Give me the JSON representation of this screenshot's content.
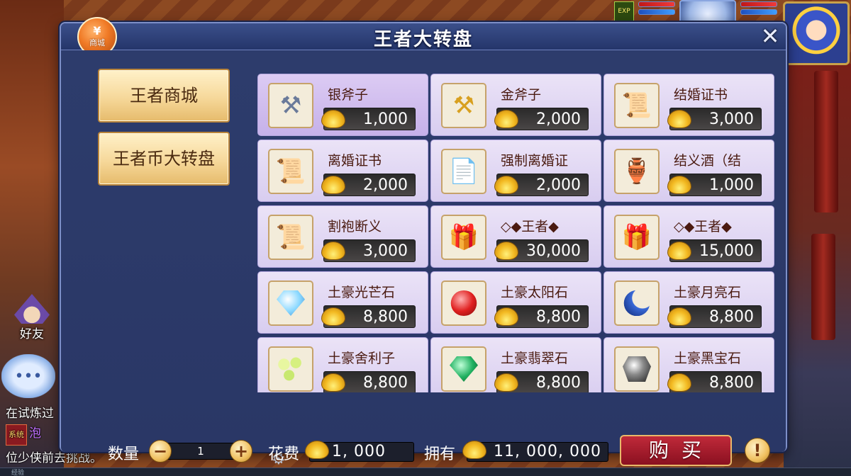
{
  "hud": {
    "chip_text": "EXP",
    "avatar": "player-avatar"
  },
  "left_overlay": {
    "friends_label": "好友",
    "chat_button": "•••",
    "chat_line_1": "在试炼过",
    "chat_tag": "系统",
    "chat_line_2": "泡",
    "chat_line_3": "位少侠前去挑战。",
    "exp_label": "经验"
  },
  "modal": {
    "title": "王者大转盘",
    "close_label": "✕",
    "shop_badge": {
      "icon": "¥",
      "label": "商城"
    },
    "tabs": [
      {
        "label": "王者商城"
      },
      {
        "label": "王者币大转盘"
      }
    ],
    "items": [
      {
        "name": "银斧子",
        "price": "1,000",
        "icon": "silver-axe-icon",
        "glyph": "⚒",
        "selected": true
      },
      {
        "name": "金斧子",
        "price": "2,000",
        "icon": "gold-axe-icon",
        "glyph": "⚒"
      },
      {
        "name": "结婚证书",
        "price": "3,000",
        "icon": "marriage-certificate-icon",
        "glyph": "📜"
      },
      {
        "name": "离婚证书",
        "price": "2,000",
        "icon": "divorce-certificate-icon",
        "glyph": "📜"
      },
      {
        "name": "强制离婚证",
        "price": "2,000",
        "icon": "forced-divorce-certificate-icon",
        "glyph": "📄"
      },
      {
        "name": "结义酒（结",
        "price": "1,000",
        "icon": "sworn-wine-icon",
        "glyph": "🏺"
      },
      {
        "name": "割袍断义",
        "price": "3,000",
        "icon": "robe-scroll-icon",
        "glyph": "📜"
      },
      {
        "name": "◇◆王者◆",
        "price": "30,000",
        "icon": "king-package-icon",
        "glyph": "🎁"
      },
      {
        "name": "◇◆王者◆",
        "price": "15,000",
        "icon": "king-package-icon",
        "glyph": "🎁"
      },
      {
        "name": "土豪光芒石",
        "price": "8,800",
        "icon": "radiance-stone-icon",
        "glyph": ""
      },
      {
        "name": "土豪太阳石",
        "price": "8,800",
        "icon": "sun-stone-icon",
        "glyph": ""
      },
      {
        "name": "土豪月亮石",
        "price": "8,800",
        "icon": "moon-stone-icon",
        "glyph": ""
      },
      {
        "name": "土豪舍利子",
        "price": "8,800",
        "icon": "sarira-icon",
        "glyph": ""
      },
      {
        "name": "土豪翡翠石",
        "price": "8,800",
        "icon": "jade-stone-icon",
        "glyph": ""
      },
      {
        "name": "土豪黑宝石",
        "price": "8,800",
        "icon": "black-gem-icon",
        "glyph": ""
      }
    ],
    "footer": {
      "quantity_label": "数量",
      "quantity_value": "1",
      "minus": "−",
      "plus": "+",
      "cost_label": "花费",
      "cost_value": "1, 000",
      "own_label": "拥有",
      "own_value": "11, 000, 000",
      "buy_label": "购买",
      "info_label": "!"
    }
  }
}
